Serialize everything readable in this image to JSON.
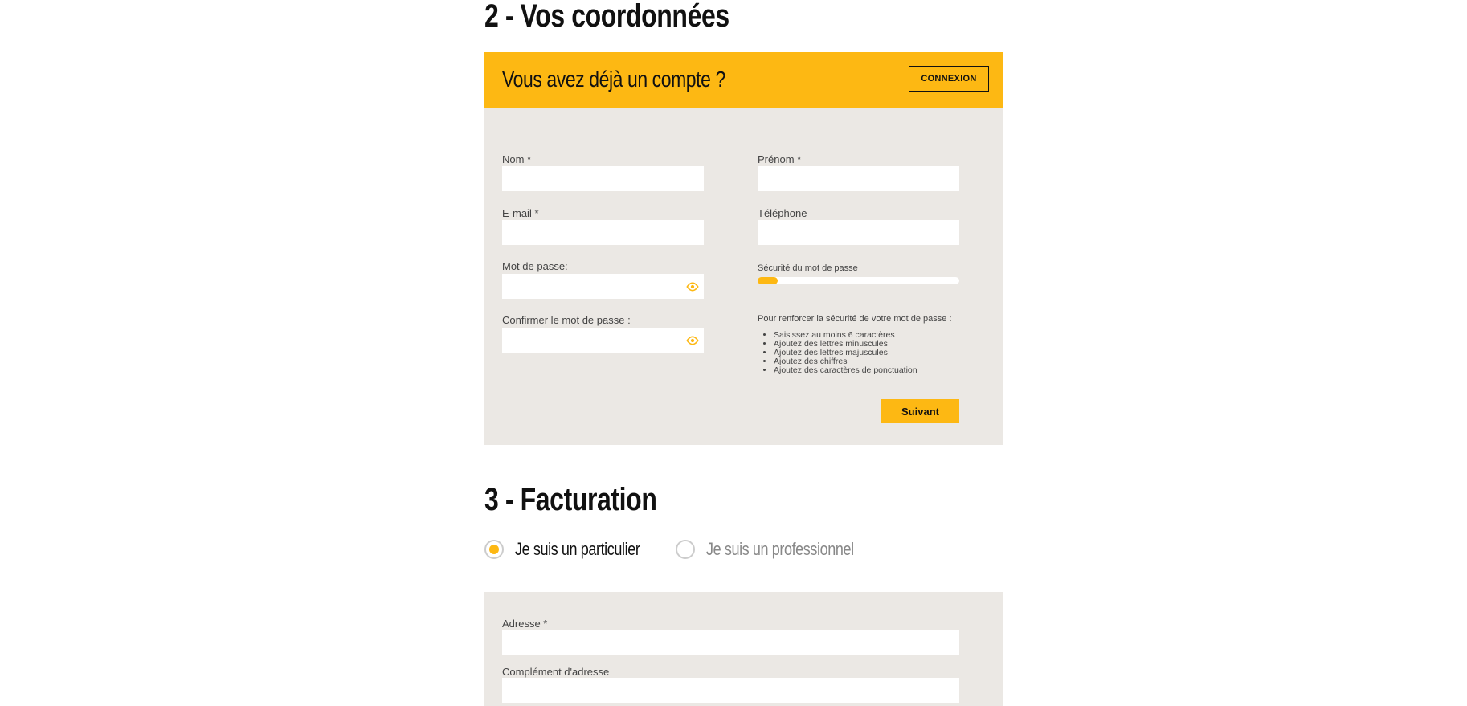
{
  "section2": {
    "title": "2 - Vos coordonnées",
    "account_banner": {
      "title": "Vous avez déjà un compte ?",
      "login_button": "CONNEXION"
    },
    "fields": {
      "nom": {
        "label": "Nom *",
        "value": ""
      },
      "prenom": {
        "label": "Prénom *",
        "value": ""
      },
      "email": {
        "label": "E-mail *",
        "value": ""
      },
      "telephone": {
        "label": "Téléphone",
        "value": ""
      },
      "password": {
        "label": "Mot de passe:",
        "value": ""
      },
      "confirm_password": {
        "label": "Confirmer le mot de passe :",
        "value": ""
      }
    },
    "password_strength": {
      "label": "Sécurité du mot de passe",
      "level": 0.1
    },
    "password_tips": {
      "intro": "Pour renforcer la sécurité de votre mot de passe :",
      "items": [
        "Saisissez au moins 6 caractères",
        "Ajoutez des lettres minuscules",
        "Ajoutez des lettres majuscules",
        "Ajoutez des chiffres",
        "Ajoutez des caractères de ponctuation"
      ]
    },
    "next_button": "Suivant"
  },
  "section3": {
    "title": "3 - Facturation",
    "customer_type": {
      "options": [
        "Je suis un particulier",
        "Je suis un professionnel"
      ],
      "selected": "Je suis un particulier"
    },
    "fields": {
      "adresse": {
        "label": "Adresse *",
        "value": ""
      },
      "complement": {
        "label": "Complément d'adresse",
        "value": ""
      }
    }
  },
  "icons": {
    "eye": "eye-icon"
  },
  "colors": {
    "accent": "#fdb813",
    "panel": "#ebe8e4",
    "text_dark": "#111111",
    "muted_text": "#888888"
  }
}
